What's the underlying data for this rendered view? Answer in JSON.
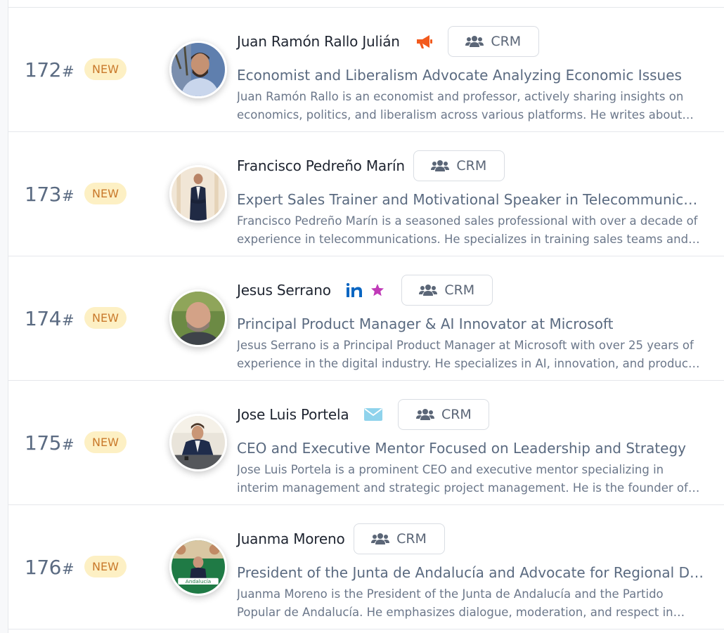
{
  "rows": [
    {
      "rank": "172",
      "hash": "#",
      "badge": "NEW",
      "name": "Juan Ramón Rallo Julián",
      "icons": [
        "megaphone-icon"
      ],
      "crm_label": "CRM",
      "headline": "Economist and Liberalism Advocate Analyzing Economic Issues",
      "description": "Juan Ramón Rallo is an economist and professor, actively sharing insights on economics, politics, and liberalism across various platforms. He writes about economic policy and liberal thought."
    },
    {
      "rank": "173",
      "hash": "#",
      "badge": "NEW",
      "name": "Francisco Pedreño Marín",
      "icons": [],
      "crm_label": "CRM",
      "headline": "Expert Sales Trainer and Motivational Speaker in Telecommunications",
      "description": "Francisco Pedreño Marín is a seasoned sales professional with over a decade of experience in telecommunications. He specializes in training sales teams and motivational speaking."
    },
    {
      "rank": "174",
      "hash": "#",
      "badge": "NEW",
      "name": "Jesus Serrano",
      "icons": [
        "linkedin-icon",
        "star-icon"
      ],
      "crm_label": "CRM",
      "headline": "Principal Product Manager & AI Innovator at Microsoft",
      "description": "Jesus Serrano is a Principal Product Manager at Microsoft with over 25 years of experience in the digital industry. He specializes in AI, innovation, and product strategy."
    },
    {
      "rank": "175",
      "hash": "#",
      "badge": "NEW",
      "name": "Jose Luis Portela",
      "icons": [
        "envelope-icon"
      ],
      "crm_label": "CRM",
      "headline": "CEO and Executive Mentor Focused on Leadership and Strategy",
      "description": "Jose Luis Portela is a prominent CEO and executive mentor specializing in interim management and strategic project management. He is the founder of several companies."
    },
    {
      "rank": "176",
      "hash": "#",
      "badge": "NEW",
      "name": "Juanma Moreno",
      "icons": [],
      "crm_label": "CRM",
      "headline": "President of the Junta de Andalucía and Advocate for Regional Development",
      "description": "Juanma Moreno is the President of the Junta de Andalucía and the Partido Popular de Andalucía. He emphasizes dialogue, moderation, and respect in politics."
    }
  ],
  "avatar_texts": {
    "row4_sign": "Andalucía"
  },
  "colors": {
    "badge_bg": "#fdf0c4",
    "badge_text": "#c9792b",
    "megaphone": "#f25a1d",
    "linkedin": "#0a66c2",
    "star": "#c03ab8",
    "envelope": "#8fd3ec"
  }
}
